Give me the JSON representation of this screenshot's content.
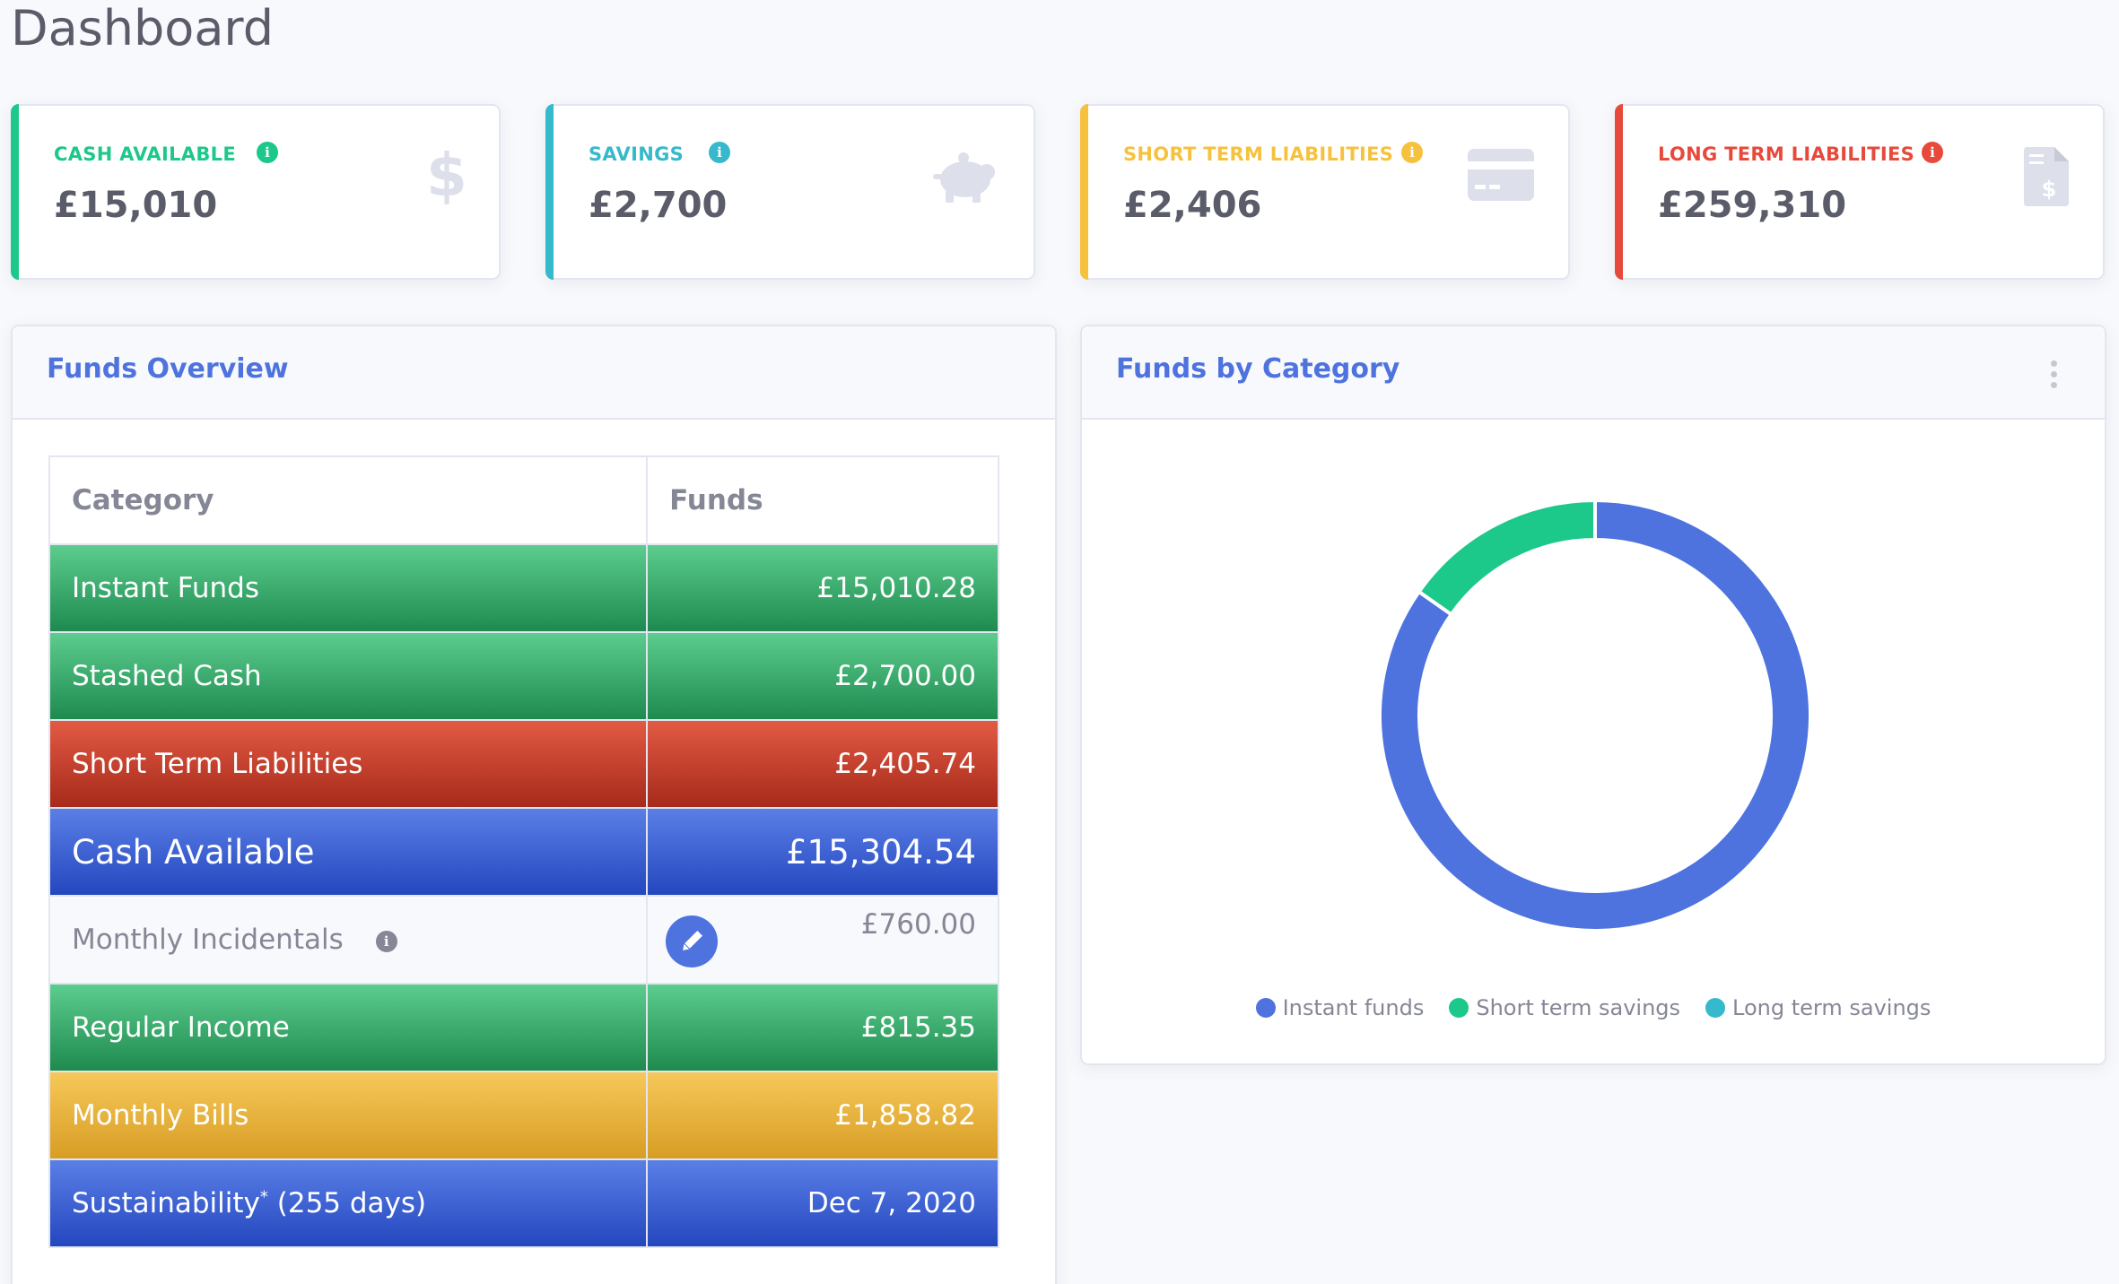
{
  "page": {
    "title": "Dashboard"
  },
  "stats": [
    {
      "label": "CASH AVAILABLE",
      "value": "£15,010",
      "color": "#36b37e",
      "icon": "dollar-icon"
    },
    {
      "label": "SAVINGS",
      "value": "£2,700",
      "color": "#36b9cc",
      "icon": "piggy-bank-icon"
    },
    {
      "label": "SHORT TERM LIABILITIES",
      "value": "£2,406",
      "color": "#f6c23e",
      "icon": "credit-card-icon"
    },
    {
      "label": "LONG TERM LIABILITIES",
      "value": "£259,310",
      "color": "#e74a3b",
      "icon": "invoice-dollar-icon"
    }
  ],
  "funds_overview": {
    "title": "Funds Overview",
    "columns": [
      "Category",
      "Funds"
    ],
    "rows": [
      {
        "category": "Instant Funds",
        "funds": "£15,010.28",
        "color": "green"
      },
      {
        "category": "Stashed Cash",
        "funds": "£2,700.00",
        "color": "green"
      },
      {
        "category": "Short Term Liabilities",
        "funds": "£2,405.74",
        "color": "red"
      },
      {
        "category": "Cash Available",
        "funds": "£15,304.54",
        "color": "blue"
      },
      {
        "category": "Monthly Incidentals",
        "funds": "£760.00",
        "color": "plain"
      },
      {
        "category": "Regular Income",
        "funds": "£815.35",
        "color": "green"
      },
      {
        "category": "Monthly Bills",
        "funds": "£1,858.82",
        "color": "yellow"
      },
      {
        "category": "Sustainability",
        "category_sup": "*",
        "category_suffix": " (255 days)",
        "funds": "Dec 7, 2020",
        "color": "blue"
      }
    ]
  },
  "funds_by_category": {
    "title": "Funds by Category"
  },
  "chart_data": {
    "type": "pie",
    "donut": true,
    "categories": [
      "Instant funds",
      "Short term savings",
      "Long term savings"
    ],
    "values": [
      15010.28,
      2700.0,
      0
    ],
    "colors": [
      "#4e73df",
      "#1cc88a",
      "#36b9cc"
    ],
    "legend_position": "bottom"
  }
}
